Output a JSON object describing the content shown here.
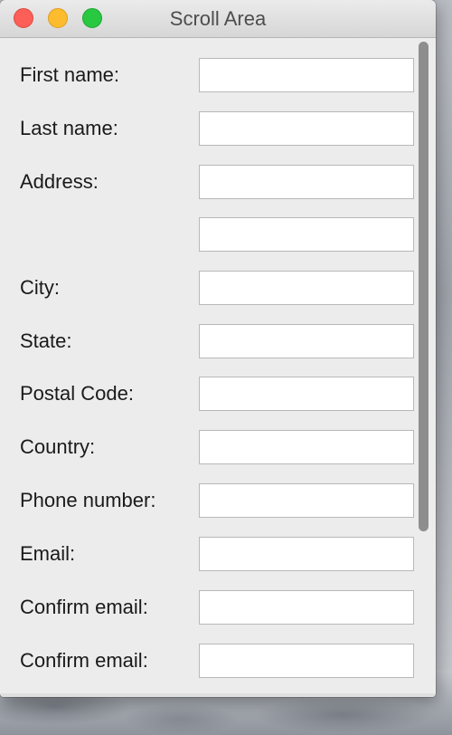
{
  "window": {
    "title": "Scroll Area"
  },
  "form": {
    "fields": [
      {
        "label": "First name:",
        "value": ""
      },
      {
        "label": "Last name:",
        "value": ""
      },
      {
        "label": "Address:",
        "value": ""
      },
      {
        "label": "",
        "value": ""
      },
      {
        "label": "City:",
        "value": ""
      },
      {
        "label": "State:",
        "value": ""
      },
      {
        "label": "Postal Code:",
        "value": ""
      },
      {
        "label": "Country:",
        "value": ""
      },
      {
        "label": "Phone number:",
        "value": ""
      },
      {
        "label": "Email:",
        "value": ""
      },
      {
        "label": "Confirm email:",
        "value": ""
      },
      {
        "label": "Confirm email:",
        "value": ""
      }
    ]
  },
  "scrollbar": {
    "visible_fraction": 0.75,
    "position": 0
  },
  "colors": {
    "close": "#fc5f57",
    "minimize": "#fdbc2e",
    "zoom": "#28c840"
  }
}
